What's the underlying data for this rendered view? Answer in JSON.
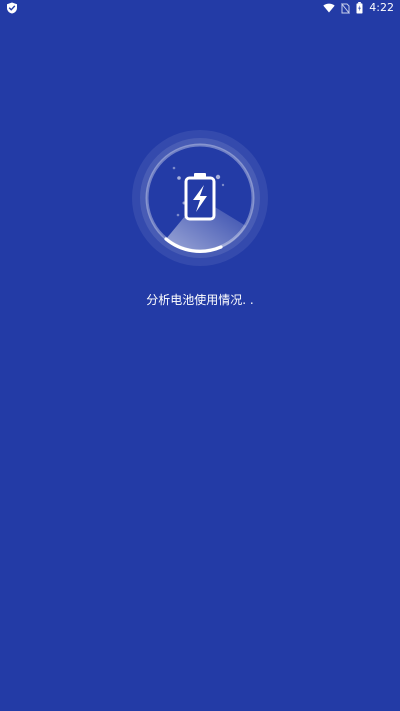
{
  "status_bar": {
    "time": "4:22",
    "left_icon": "shield-icon",
    "icons": [
      "wifi-icon",
      "no-sim-icon",
      "battery-icon"
    ]
  },
  "scanner": {
    "icon": "battery-charging-icon"
  },
  "message": {
    "text": "分析电池使用情况. ."
  },
  "colors": {
    "background": "#233ba6",
    "foreground": "#ffffff"
  }
}
